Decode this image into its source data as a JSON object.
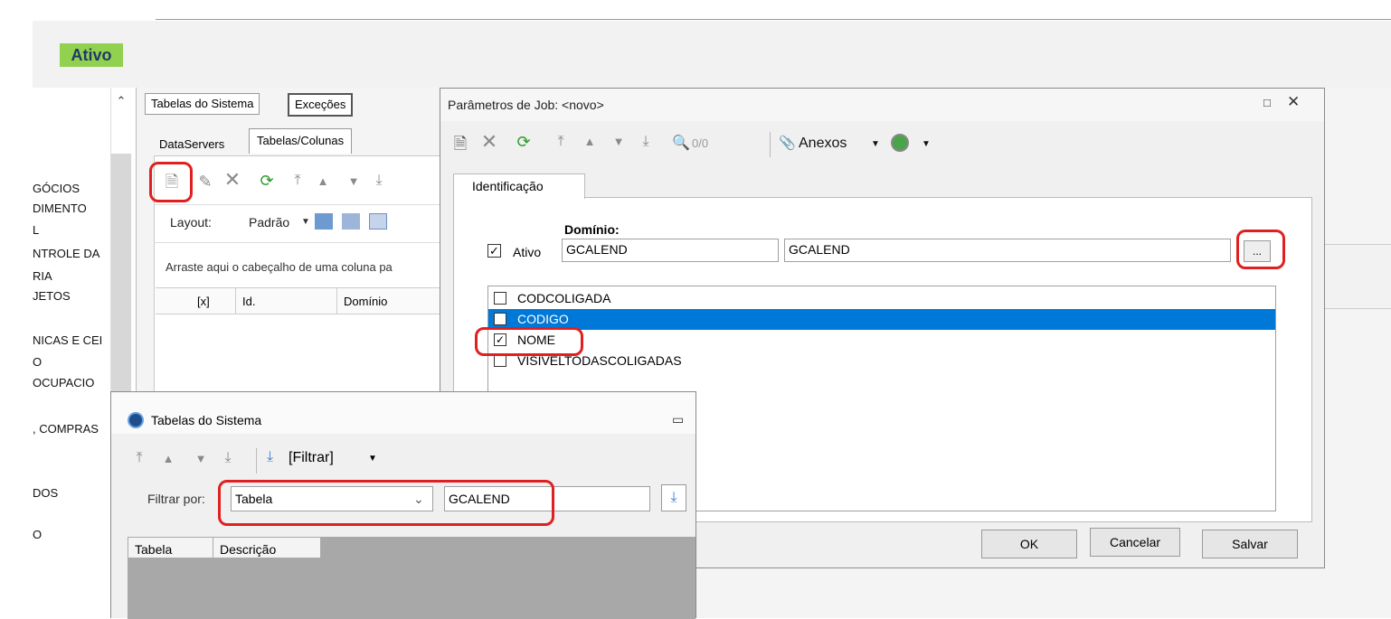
{
  "header": {
    "status_badge": "Ativo"
  },
  "sidebar": {
    "items": [
      {
        "label": "GÓCIOS"
      },
      {
        "label": "DIMENTO"
      },
      {
        "label": "L"
      },
      {
        "label": "NTROLE DA"
      },
      {
        "label": "RIA"
      },
      {
        "label": "JETOS"
      },
      {
        "label": "NICAS E CEI"
      },
      {
        "label": "O"
      },
      {
        "label": "OCUPACIO"
      },
      {
        "label": ", COMPRAS"
      },
      {
        "label": "DOS"
      },
      {
        "label": "O"
      }
    ]
  },
  "main": {
    "tabs": [
      "Tabelas do Sistema",
      "Exceções"
    ],
    "subtabs": [
      "DataServers",
      "Tabelas/Colunas"
    ],
    "layout_label": "Layout:",
    "layout_value": "Padrão",
    "group_hint": "Arraste aqui o cabeçalho de uma coluna pa",
    "columns": [
      "[x]",
      "Id.",
      "Domínio"
    ]
  },
  "job_dialog": {
    "title": "Parâmetros de Job: <novo>",
    "counter": "0/0",
    "attachments_label": "Anexos",
    "tab": "Identificação",
    "dominio_label": "Domínio:",
    "ativo_label": "Ativo",
    "dominio_code": "GCALEND",
    "dominio_name": "GCALEND",
    "browse_label": "...",
    "columns": [
      {
        "name": "CODCOLIGADA",
        "checked": false,
        "selected": false
      },
      {
        "name": "CODIGO",
        "checked": false,
        "selected": true
      },
      {
        "name": "NOME",
        "checked": true,
        "selected": false
      },
      {
        "name": "VISIVELTODASCOLIGADAS",
        "checked": false,
        "selected": false
      }
    ],
    "buttons": {
      "ok": "OK",
      "cancel": "Cancelar",
      "save": "Salvar"
    }
  },
  "tables_dialog": {
    "title": "Tabelas do Sistema",
    "filter_button": "[Filtrar]",
    "filter_by_label": "Filtrar por:",
    "filter_field": "Tabela",
    "filter_value": "GCALEND",
    "grid_columns": [
      "Tabela",
      "Descrição"
    ]
  },
  "colors": {
    "accent_red": "#e02020",
    "badge_green": "#92d050",
    "selection_blue": "#0078d7"
  }
}
